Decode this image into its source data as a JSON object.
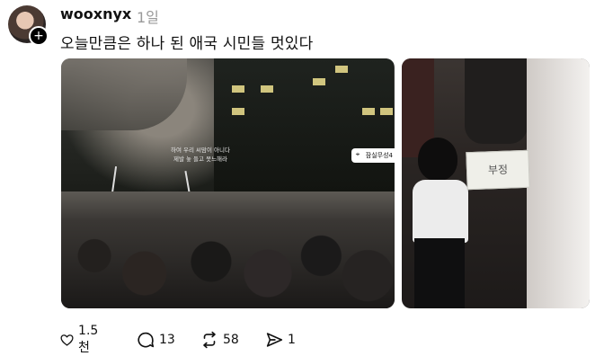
{
  "post": {
    "username": "wooxnyx",
    "time_ago": "1일",
    "text": "오늘만큼은 하나 된 애국 시민들 멋있다"
  },
  "photo1": {
    "caption_line1": "하여 우리 씨맘이 아니다",
    "caption_line2": "제발 놓 들고 못느해라",
    "location_tag": "잠실무성4"
  },
  "photo2": {
    "sign_text": "부정"
  },
  "actions": {
    "likes": "1.5천",
    "comments": "13",
    "reposts": "58",
    "shares": "1"
  },
  "icons": {
    "like": "heart-icon",
    "comment": "comment-icon",
    "repost": "repost-icon",
    "share": "share-icon",
    "follow": "plus-icon",
    "location": "pin-icon"
  }
}
